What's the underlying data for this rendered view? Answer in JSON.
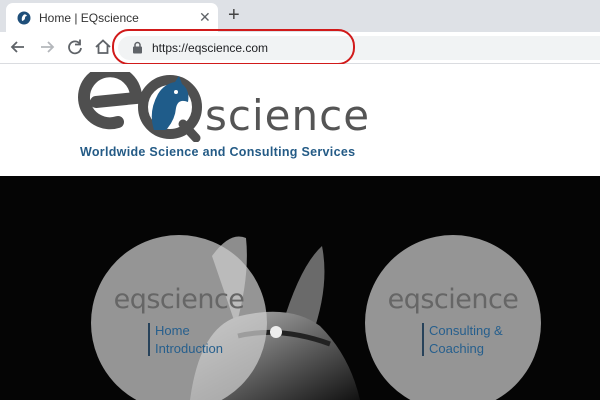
{
  "browser": {
    "tab": {
      "title": "Home | EQscience",
      "close_icon": "close-icon",
      "favicon": "eqscience-favicon-icon"
    },
    "new_tab_symbol": "+",
    "nav": {
      "back": "back-arrow-icon",
      "forward": "forward-arrow-icon",
      "reload": "reload-icon",
      "home": "home-icon"
    },
    "address": {
      "url": "https://eqscience.com",
      "secure_icon": "lock-icon",
      "highlight_color": "#d11a1a"
    }
  },
  "header": {
    "logo_text": "science",
    "tagline": "Worldwide Science and Consulting Services",
    "brand_gray": "#555555",
    "brand_blue": "#245b86"
  },
  "hero": {
    "background": "#050505",
    "cards": [
      {
        "brand": "eqscience",
        "line1": "Home",
        "line2": "Introduction"
      },
      {
        "brand": "eqscience",
        "line1": "Consulting &",
        "line2": "Coaching"
      }
    ]
  }
}
